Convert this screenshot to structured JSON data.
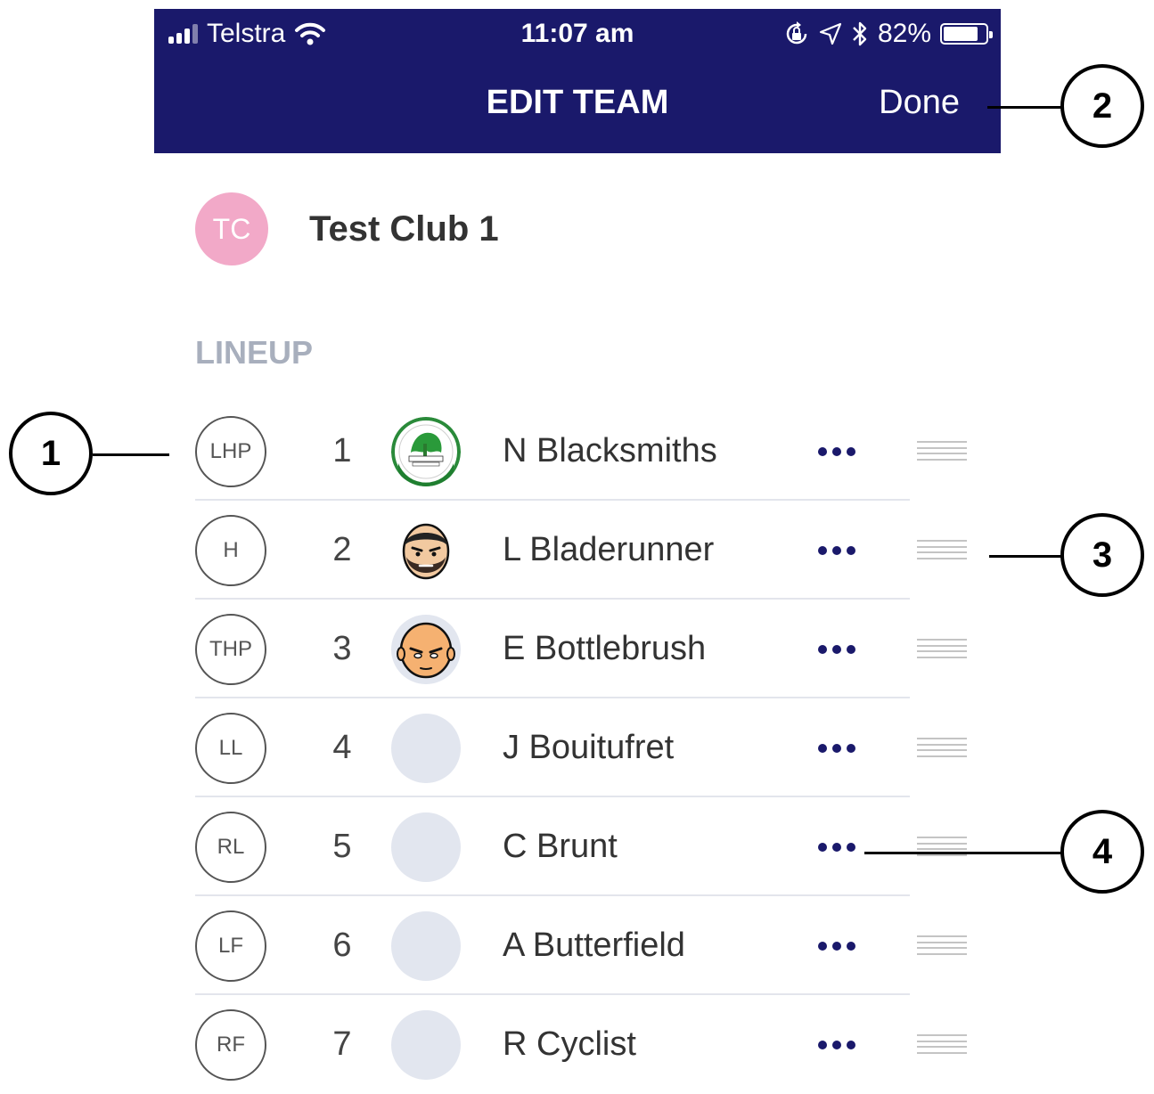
{
  "status_bar": {
    "carrier": "Telstra",
    "time": "11:07 am",
    "battery_percent": "82%",
    "battery_level": 0.82
  },
  "nav": {
    "title": "EDIT TEAM",
    "done_label": "Done"
  },
  "team": {
    "initials": "TC",
    "name": "Test Club 1",
    "avatar_color": "#f2a9c8"
  },
  "section_label": "LINEUP",
  "players": [
    {
      "position": "LHP",
      "number": "1",
      "name": "N Blacksmiths",
      "avatar": "club-logo"
    },
    {
      "position": "H",
      "number": "2",
      "name": "L Bladerunner",
      "avatar": "bearded-face"
    },
    {
      "position": "THP",
      "number": "3",
      "name": "E Bottlebrush",
      "avatar": "bald-face"
    },
    {
      "position": "LL",
      "number": "4",
      "name": "J Bouitufret",
      "avatar": "placeholder"
    },
    {
      "position": "RL",
      "number": "5",
      "name": "C Brunt",
      "avatar": "placeholder"
    },
    {
      "position": "LF",
      "number": "6",
      "name": "A Butterfield",
      "avatar": "placeholder"
    },
    {
      "position": "RF",
      "number": "7",
      "name": "R Cyclist",
      "avatar": "placeholder"
    }
  ],
  "callouts": [
    "1",
    "2",
    "3",
    "4"
  ],
  "colors": {
    "navbar": "#1a196b",
    "accent_dots": "#1a196b",
    "section_label": "#a8afbd",
    "divider": "#e3e5ec",
    "avatar_placeholder": "#e2e6ef"
  }
}
